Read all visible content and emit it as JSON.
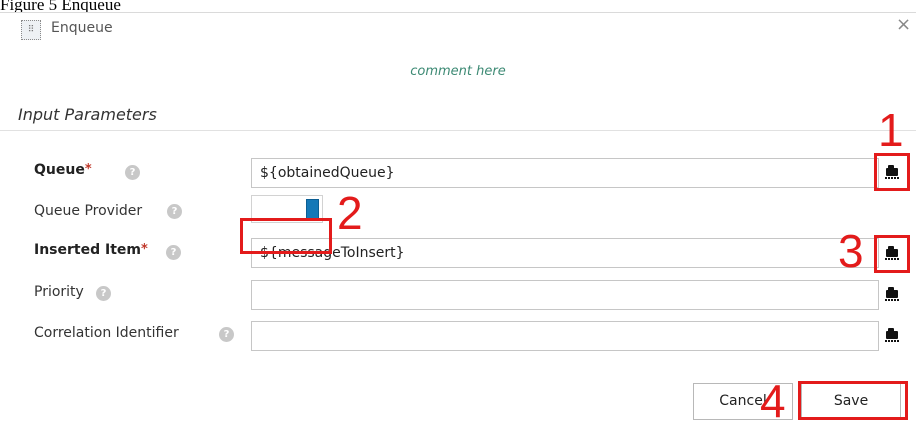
{
  "caption": "Figure 5 Enqueue",
  "dialog": {
    "title": "Enqueue",
    "title_icon": "grid-icon",
    "close_label": "×",
    "comment": "comment here",
    "section_title": "Input Parameters",
    "help_glyph": "?",
    "required_marker": "*",
    "fields": {
      "queue": {
        "label": "Queue",
        "value": "${obtainedQueue}"
      },
      "queue_provider": {
        "label": "Queue Provider"
      },
      "inserted_item": {
        "label": "Inserted Item",
        "value": "${messageToInsert}"
      },
      "priority": {
        "label": "Priority",
        "value": ""
      },
      "correlation_identifier": {
        "label": "Correlation Identifier",
        "value": ""
      }
    },
    "buttons": {
      "cancel": "Cancel",
      "save": "Save"
    }
  },
  "annotations": [
    "1",
    "2",
    "3",
    "4"
  ],
  "colors": {
    "annotation": "#e31b1b",
    "toggle_knob": "#1478b7",
    "comment": "#3d8a74"
  }
}
